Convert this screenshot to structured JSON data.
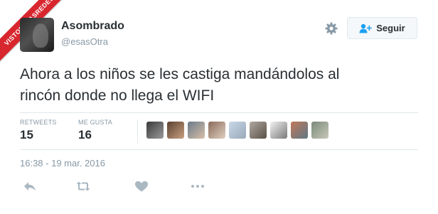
{
  "watermark": {
    "text": "VISTOENLASREDES"
  },
  "author": {
    "name": "Asombrado",
    "handle": "@esasOtra"
  },
  "header": {
    "settings_icon": "gear-icon",
    "follow_label": "Seguir",
    "follow_icon": "add-user-icon"
  },
  "tweet": {
    "line1": "Ahora a los niños se les castiga mandándolos al",
    "line2": "rincón donde no llega el WIFI"
  },
  "stats": {
    "retweets_label": "RETWEETS",
    "retweets_value": "15",
    "likes_label": "ME GUSTA",
    "likes_value": "16"
  },
  "likers_count_shown": 9,
  "timestamp": "16:38 - 19 mar. 2016",
  "actions": [
    "reply-icon",
    "retweet-icon",
    "like-icon",
    "more-icon"
  ],
  "colors": {
    "text": "#292f33",
    "muted": "#8899a6",
    "divider": "#e1e8ed",
    "accent": "#1da1f2",
    "ribbon": "#d8262e"
  }
}
